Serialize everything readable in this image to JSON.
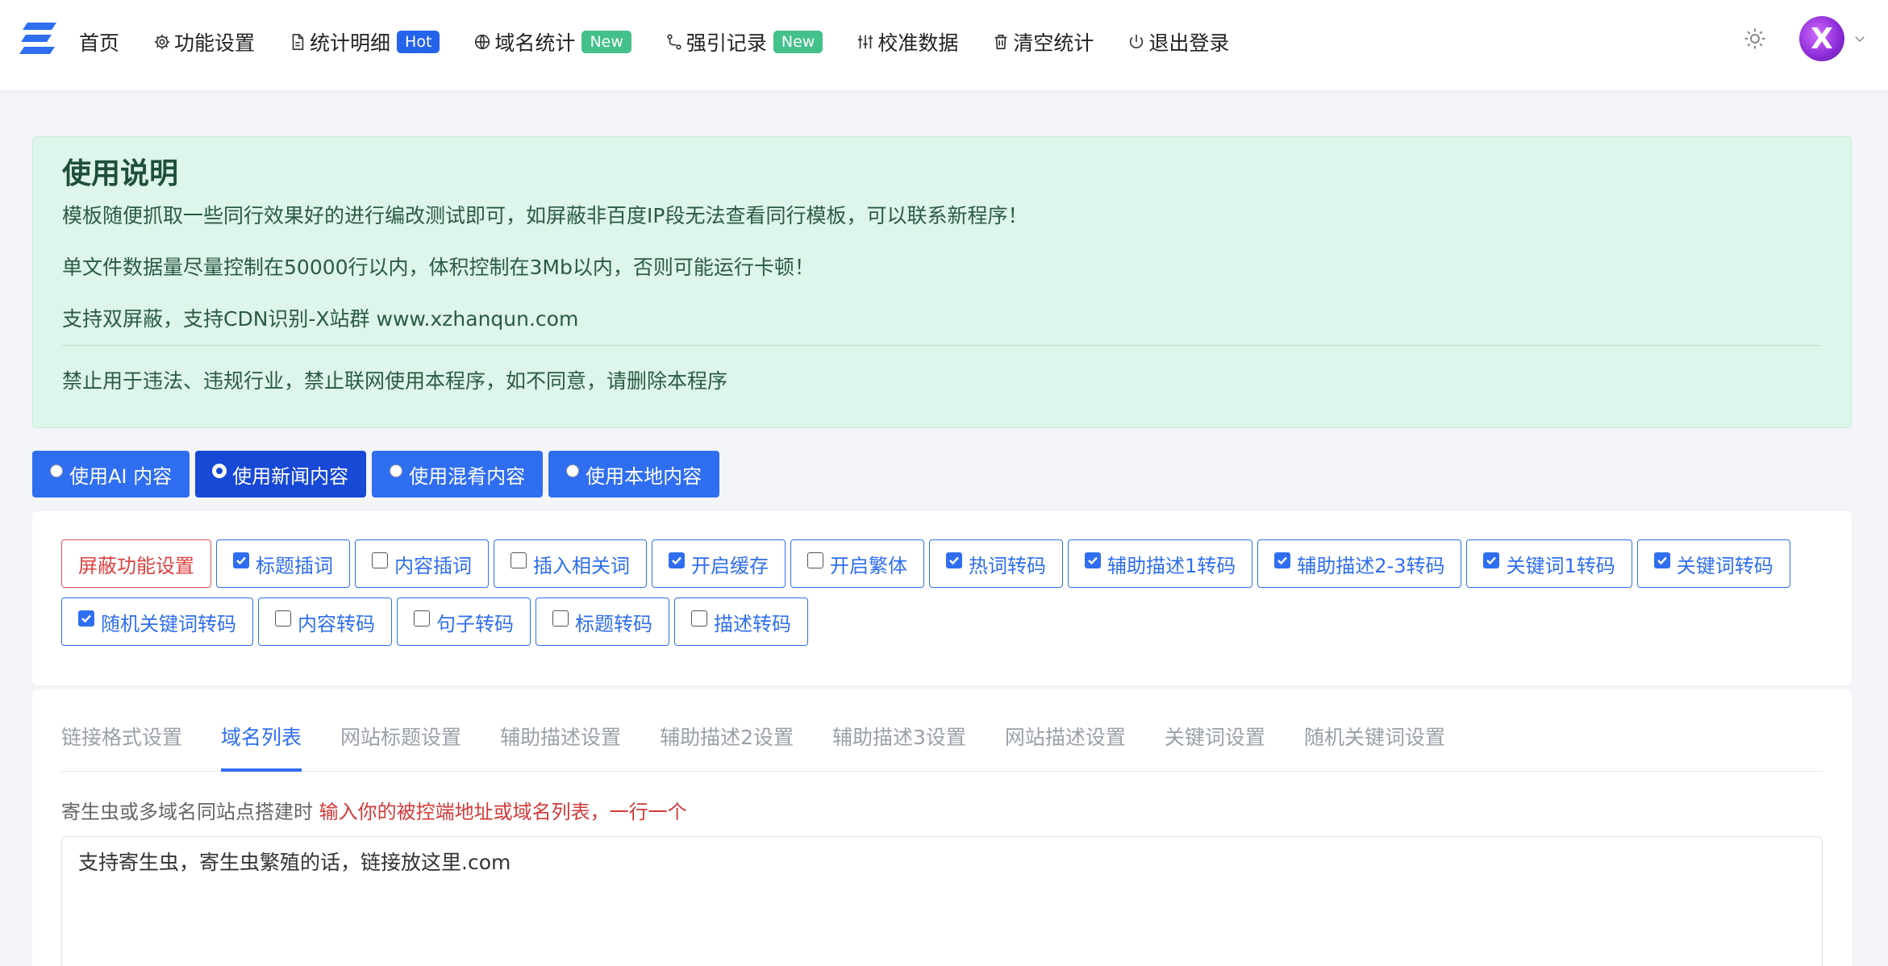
{
  "nav": {
    "items": [
      {
        "label": "首页",
        "icon": "none",
        "badge": ""
      },
      {
        "label": "功能设置",
        "icon": "gear-icon",
        "badge": ""
      },
      {
        "label": "统计明细",
        "icon": "document-icon",
        "badge": "Hot"
      },
      {
        "label": "域名统计",
        "icon": "globe-icon",
        "badge": "New"
      },
      {
        "label": "强引记录",
        "icon": "route-icon",
        "badge": "New"
      },
      {
        "label": "校准数据",
        "icon": "sliders-icon",
        "badge": ""
      },
      {
        "label": "清空统计",
        "icon": "trash-icon",
        "badge": ""
      },
      {
        "label": "退出登录",
        "icon": "power-icon",
        "badge": ""
      }
    ],
    "avatar_letter": "X"
  },
  "notice": {
    "title": "使用说明",
    "line1": "模板随便抓取一些同行效果好的进行编改测试即可，如屏蔽非百度IP段无法查看同行模板，可以联系新程序！",
    "line2": "单文件数据量尽量控制在50000行以内，体积控制在3Mb以内，否则可能运行卡顿！",
    "line3": "支持双屏蔽，支持CDN识别-X站群 www.xzhanqun.com",
    "line4": "禁止用于违法、违规行业，禁止联网使用本程序，如不同意，请删除本程序"
  },
  "modes": [
    {
      "label": "使用AI 内容",
      "selected": false
    },
    {
      "label": "使用新闻内容",
      "selected": true
    },
    {
      "label": "使用混肴内容",
      "selected": false
    },
    {
      "label": "使用本地内容",
      "selected": false
    }
  ],
  "features": {
    "block_label": "屏蔽功能设置",
    "row1": [
      {
        "label": "标题插词",
        "checked": true
      },
      {
        "label": "内容插词",
        "checked": false
      },
      {
        "label": "插入相关词",
        "checked": false
      },
      {
        "label": "开启缓存",
        "checked": true
      },
      {
        "label": "开启繁体",
        "checked": false
      },
      {
        "label": "热词转码",
        "checked": true
      },
      {
        "label": "辅助描述1转码",
        "checked": true
      },
      {
        "label": "辅助描述2-3转码",
        "checked": true
      },
      {
        "label": "关键词1转码",
        "checked": true
      },
      {
        "label": "关键词转码",
        "checked": true
      }
    ],
    "row2": [
      {
        "label": "随机关键词转码",
        "checked": true
      },
      {
        "label": "内容转码",
        "checked": false
      },
      {
        "label": "句子转码",
        "checked": false
      },
      {
        "label": "标题转码",
        "checked": false
      },
      {
        "label": "描述转码",
        "checked": false
      }
    ]
  },
  "tabs": {
    "items": [
      "链接格式设置",
      "域名列表",
      "网站标题设置",
      "辅助描述设置",
      "辅助描述2设置",
      "辅助描述3设置",
      "网站描述设置",
      "关键词设置",
      "随机关键词设置"
    ],
    "active_index": 1
  },
  "domain_list": {
    "hint_prefix": "寄生虫或多域名同站点搭建时",
    "hint_red": "输入你的被控端地址或域名列表，一行一个",
    "content": "支持寄生虫，寄生虫繁殖的话，链接放这里.com"
  },
  "colors": {
    "primary": "#2f6ef0",
    "active_mode": "#1748d6",
    "notice_bg": "#ddf5ea",
    "hot_badge": "#2563eb",
    "new_badge": "#44c08a",
    "danger": "#e04040"
  }
}
